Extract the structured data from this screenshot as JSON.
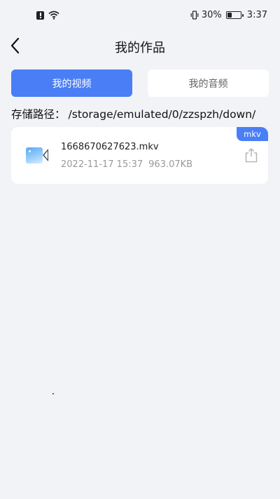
{
  "status_bar": {
    "battery_text": "30%",
    "battery_level": 0.3,
    "time": "3:37"
  },
  "header": {
    "title": "我的作品"
  },
  "tabs": [
    {
      "label": "我的视频",
      "active": true
    },
    {
      "label": "我的音频",
      "active": false
    }
  ],
  "storage": {
    "label": "存储路径：",
    "path": "/storage/emulated/0/zzspzh/down/"
  },
  "files": [
    {
      "name": "1668670627623.mkv",
      "date": "2022-11-17 15:37",
      "size": "963.07KB",
      "ext": "mkv"
    }
  ],
  "colors": {
    "accent": "#4a7ef6",
    "background": "#f2f3f7",
    "card": "#ffffff",
    "meta_text": "#9a9a9a"
  },
  "icons": [
    "alert-icon",
    "wifi-icon",
    "vibrate-icon",
    "battery-icon",
    "back-arrow-icon",
    "video-file-icon",
    "share-icon"
  ]
}
